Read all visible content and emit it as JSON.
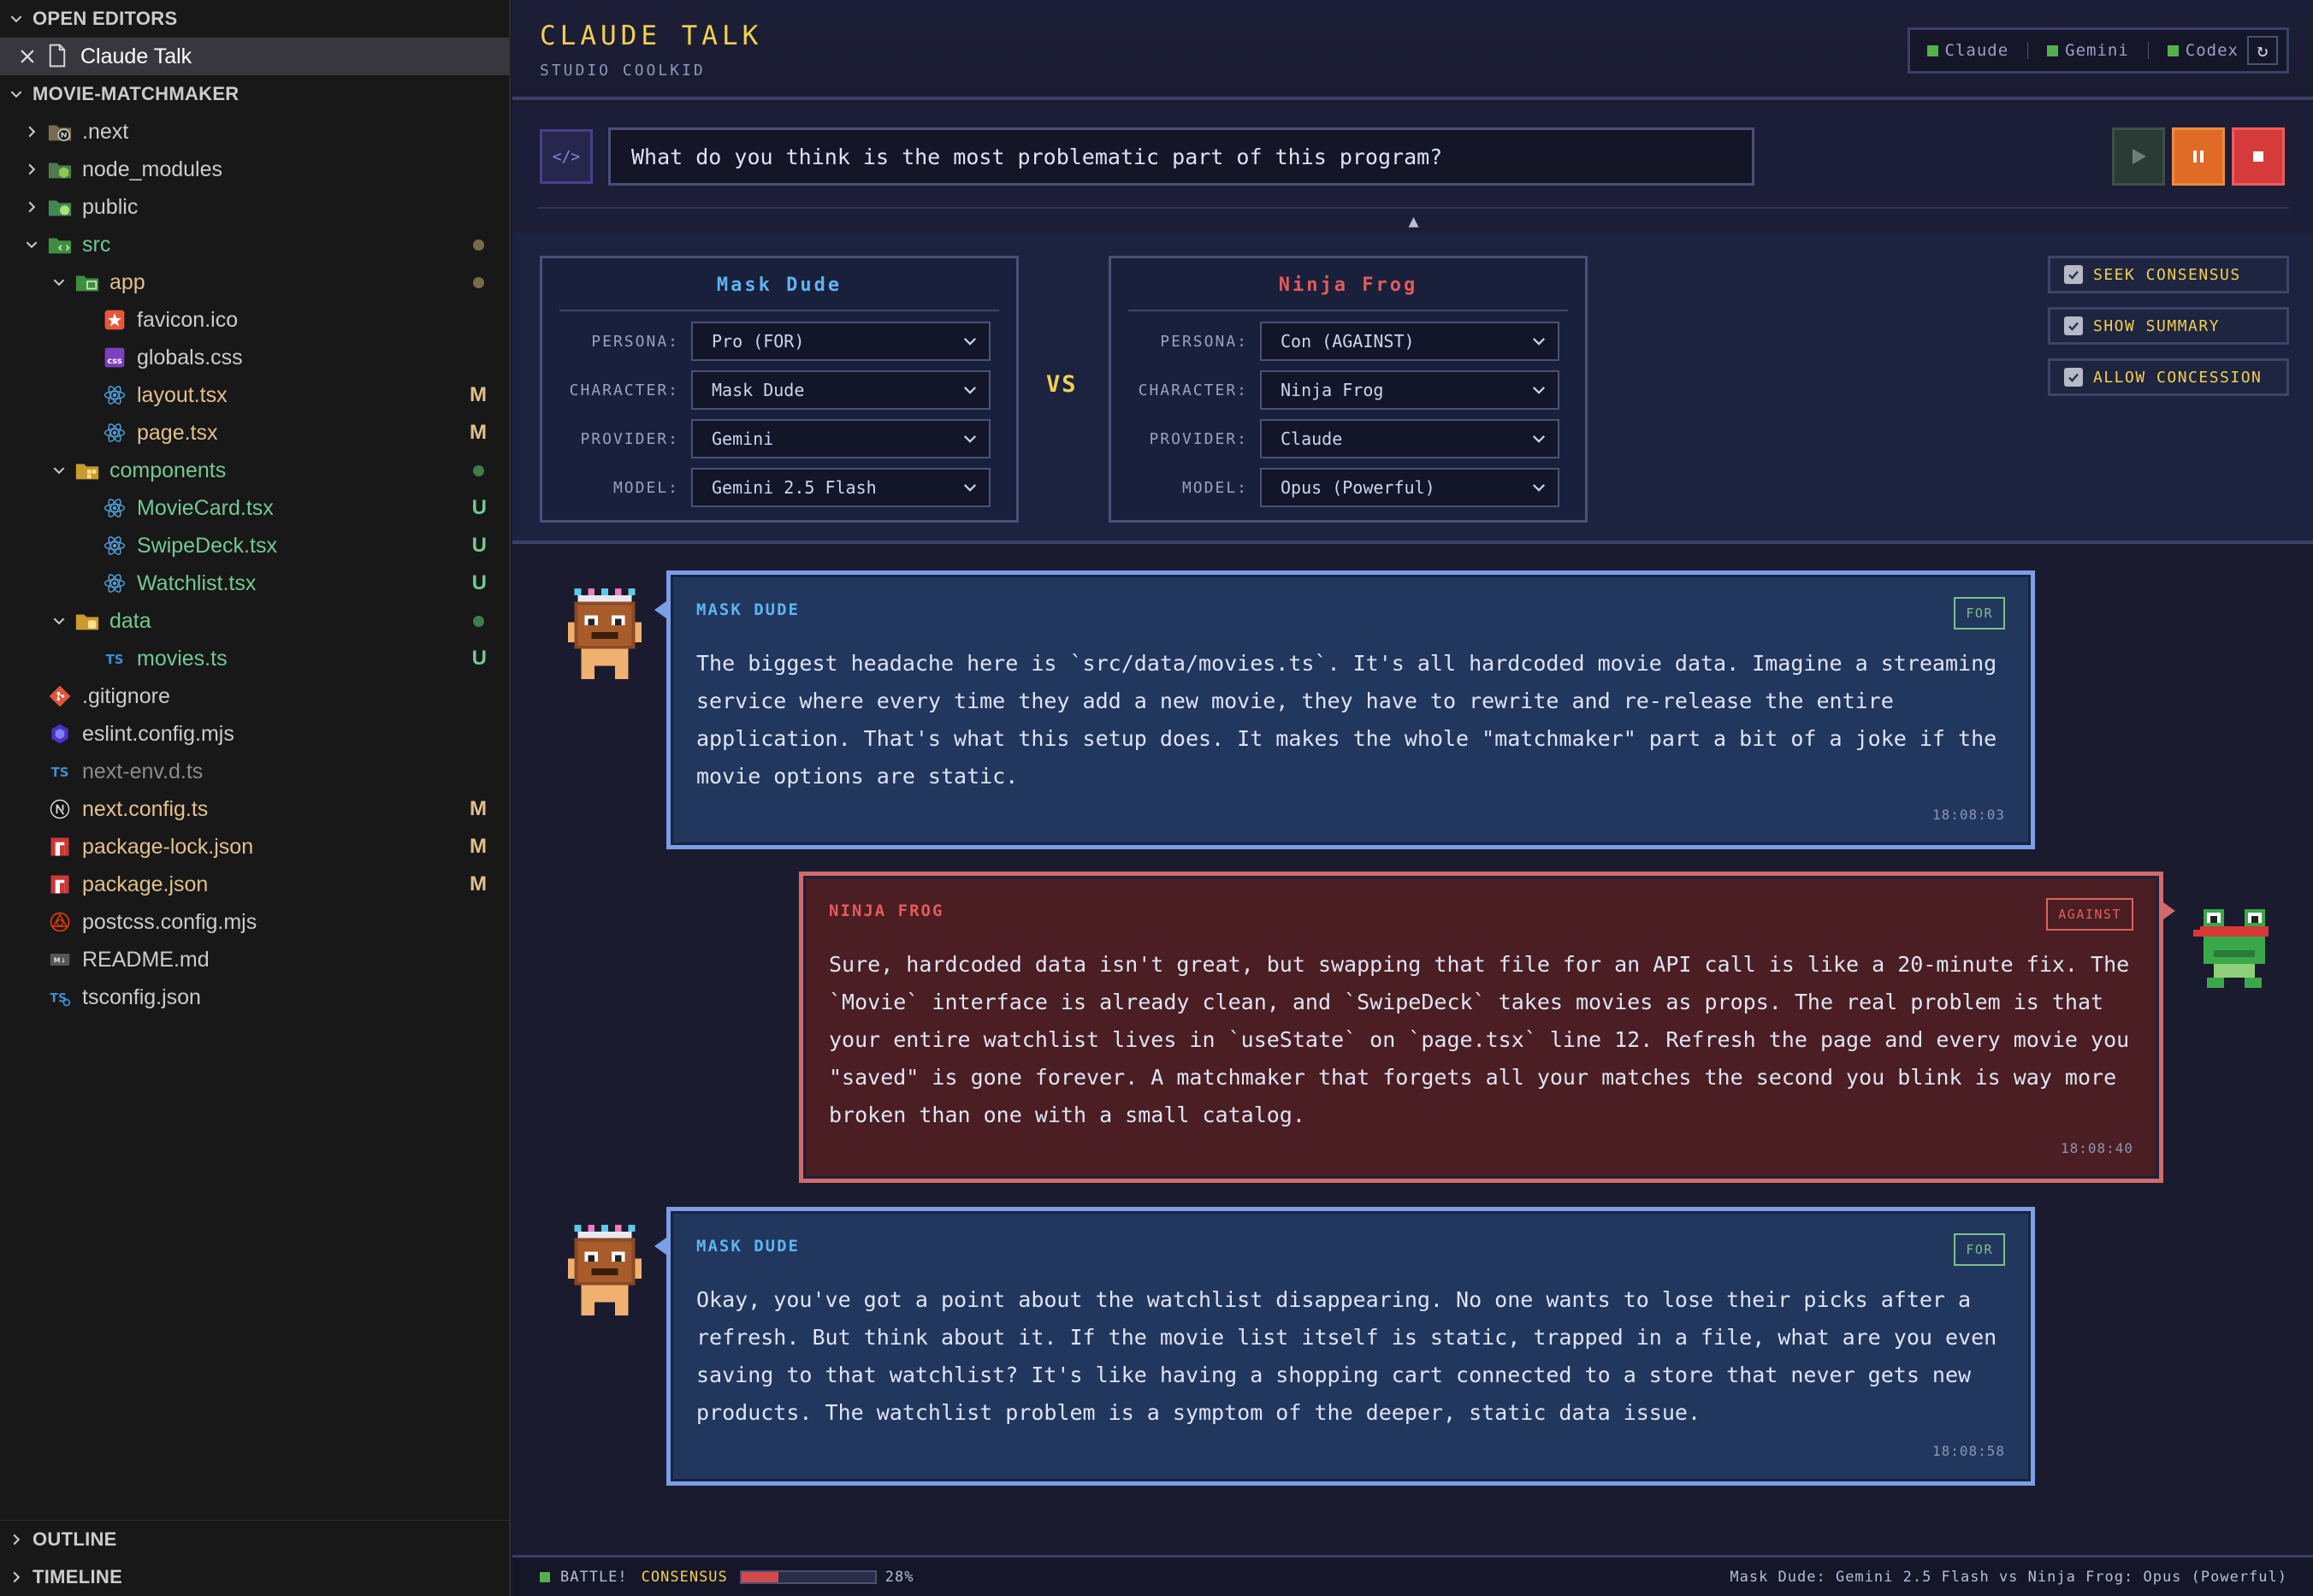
{
  "sidebar": {
    "open_editors_label": "OPEN EDITORS",
    "open_file": "Claude Talk",
    "project_label": "MOVIE-MATCHMAKER",
    "tree": [
      {
        "name": ".next",
        "depth": 0,
        "type": "folder",
        "expanded": false,
        "icon": "next-folder-icon",
        "status": ""
      },
      {
        "name": "node_modules",
        "depth": 0,
        "type": "folder",
        "expanded": false,
        "icon": "node-folder-icon",
        "status": ""
      },
      {
        "name": "public",
        "depth": 0,
        "type": "folder",
        "expanded": false,
        "icon": "public-folder-icon",
        "status": ""
      },
      {
        "name": "src",
        "depth": 0,
        "type": "folder",
        "expanded": true,
        "icon": "src-folder-icon",
        "status": "dot-mod"
      },
      {
        "name": "app",
        "depth": 1,
        "type": "folder",
        "expanded": true,
        "icon": "app-folder-icon",
        "status": "dot-mod"
      },
      {
        "name": "favicon.ico",
        "depth": 2,
        "type": "file",
        "icon": "favicon-icon",
        "status": ""
      },
      {
        "name": "globals.css",
        "depth": 2,
        "type": "file",
        "icon": "css-icon",
        "status": ""
      },
      {
        "name": "layout.tsx",
        "depth": 2,
        "type": "file",
        "icon": "react-icon",
        "status": "M"
      },
      {
        "name": "page.tsx",
        "depth": 2,
        "type": "file",
        "icon": "react-icon",
        "status": "M"
      },
      {
        "name": "components",
        "depth": 1,
        "type": "folder",
        "expanded": true,
        "icon": "components-folder-icon",
        "status": "dot-unt"
      },
      {
        "name": "MovieCard.tsx",
        "depth": 2,
        "type": "file",
        "icon": "react-icon",
        "status": "U"
      },
      {
        "name": "SwipeDeck.tsx",
        "depth": 2,
        "type": "file",
        "icon": "react-icon",
        "status": "U"
      },
      {
        "name": "Watchlist.tsx",
        "depth": 2,
        "type": "file",
        "icon": "react-icon",
        "status": "U"
      },
      {
        "name": "data",
        "depth": 1,
        "type": "folder",
        "expanded": true,
        "icon": "data-folder-icon",
        "status": "dot-unt"
      },
      {
        "name": "movies.ts",
        "depth": 2,
        "type": "file",
        "icon": "ts-icon",
        "status": "U"
      },
      {
        "name": ".gitignore",
        "depth": 0,
        "type": "file",
        "icon": "git-icon",
        "status": ""
      },
      {
        "name": "eslint.config.mjs",
        "depth": 0,
        "type": "file",
        "icon": "eslint-icon",
        "status": ""
      },
      {
        "name": "next-env.d.ts",
        "depth": 0,
        "type": "file",
        "icon": "ts-icon",
        "status": "dim"
      },
      {
        "name": "next.config.ts",
        "depth": 0,
        "type": "file",
        "icon": "next-icon",
        "status": "M"
      },
      {
        "name": "package-lock.json",
        "depth": 0,
        "type": "file",
        "icon": "npm-icon",
        "status": "M"
      },
      {
        "name": "package.json",
        "depth": 0,
        "type": "file",
        "icon": "npm-icon",
        "status": "M"
      },
      {
        "name": "postcss.config.mjs",
        "depth": 0,
        "type": "file",
        "icon": "postcss-icon",
        "status": ""
      },
      {
        "name": "README.md",
        "depth": 0,
        "type": "file",
        "icon": "markdown-icon",
        "status": ""
      },
      {
        "name": "tsconfig.json",
        "depth": 0,
        "type": "file",
        "icon": "tsconfig-icon",
        "status": ""
      }
    ],
    "outline_label": "OUTLINE",
    "timeline_label": "TIMELINE"
  },
  "app": {
    "title": "CLAUDE TALK",
    "subtitle": "STUDIO COOLKID",
    "providers": [
      "Claude",
      "Gemini",
      "Codex"
    ],
    "refresh_glyph": "↻",
    "code_button": "</>",
    "prompt": "What do you think is the most problematic part of this program?",
    "collapse_glyph": "▲",
    "vs": "VS"
  },
  "fighters": [
    {
      "title": "Mask Dude",
      "color": "#5fb4f0",
      "fields": [
        {
          "label": "PERSONA:",
          "value": "Pro (FOR)"
        },
        {
          "label": "CHARACTER:",
          "value": "Mask Dude"
        },
        {
          "label": "PROVIDER:",
          "value": "Gemini"
        },
        {
          "label": "MODEL:",
          "value": "Gemini 2.5 Flash"
        }
      ]
    },
    {
      "title": "Ninja Frog",
      "color": "#e55a5a",
      "fields": [
        {
          "label": "PERSONA:",
          "value": "Con (AGAINST)"
        },
        {
          "label": "CHARACTER:",
          "value": "Ninja Frog"
        },
        {
          "label": "PROVIDER:",
          "value": "Claude"
        },
        {
          "label": "MODEL:",
          "value": "Opus (Powerful)"
        }
      ]
    }
  ],
  "options": [
    {
      "label": "SEEK CONSENSUS",
      "checked": true
    },
    {
      "label": "SHOW SUMMARY",
      "checked": true
    },
    {
      "label": "ALLOW CONCESSION",
      "checked": true
    }
  ],
  "messages": [
    {
      "speaker": "MASK DUDE",
      "side": "left",
      "tag": "FOR",
      "text": "The biggest headache here is `src/data/movies.ts`. It's all hardcoded movie data. Imagine a streaming service where every time they add a new movie, they have to rewrite and re-release the entire application. That's what this setup does. It makes the whole \"matchmaker\" part a bit of a joke if the movie options are static.",
      "time": "18:08:03"
    },
    {
      "speaker": "NINJA FROG",
      "side": "right",
      "tag": "AGAINST",
      "text": "Sure, hardcoded data isn't great, but swapping that file for an API call is like a 20-minute fix. The `Movie` interface is already clean, and `SwipeDeck` takes movies as props. The real problem is that your entire watchlist lives in `useState` on `page.tsx` line 12. Refresh the page and every movie you \"saved\" is gone forever. A matchmaker that forgets all your matches the second you blink is way more broken than one with a small catalog.",
      "time": "18:08:40"
    },
    {
      "speaker": "MASK DUDE",
      "side": "left",
      "tag": "FOR",
      "text": "Okay, you've got a point about the watchlist disappearing. No one wants to lose their picks after a refresh. But think about it. If the movie list itself is static, trapped in a file, what are you even saving to that watchlist? It's like having a shopping cart connected to a store that never gets new products. The watchlist problem is a symptom of the deeper, static data issue.",
      "time": "18:08:58"
    }
  ],
  "status": {
    "mode": "BATTLE!",
    "consensus_label": "CONSENSUS",
    "consensus_percent": 28,
    "consensus_text": "28%",
    "matchup": "Mask Dude: Gemini 2.5 Flash vs Ninja Frog: Opus (Powerful)"
  },
  "colors": {
    "accent_yellow": "#f2d04f",
    "for_blue": "#5fb4f0",
    "against_red": "#e55a5a",
    "modified": "#e2c08d",
    "untracked": "#73c991"
  }
}
